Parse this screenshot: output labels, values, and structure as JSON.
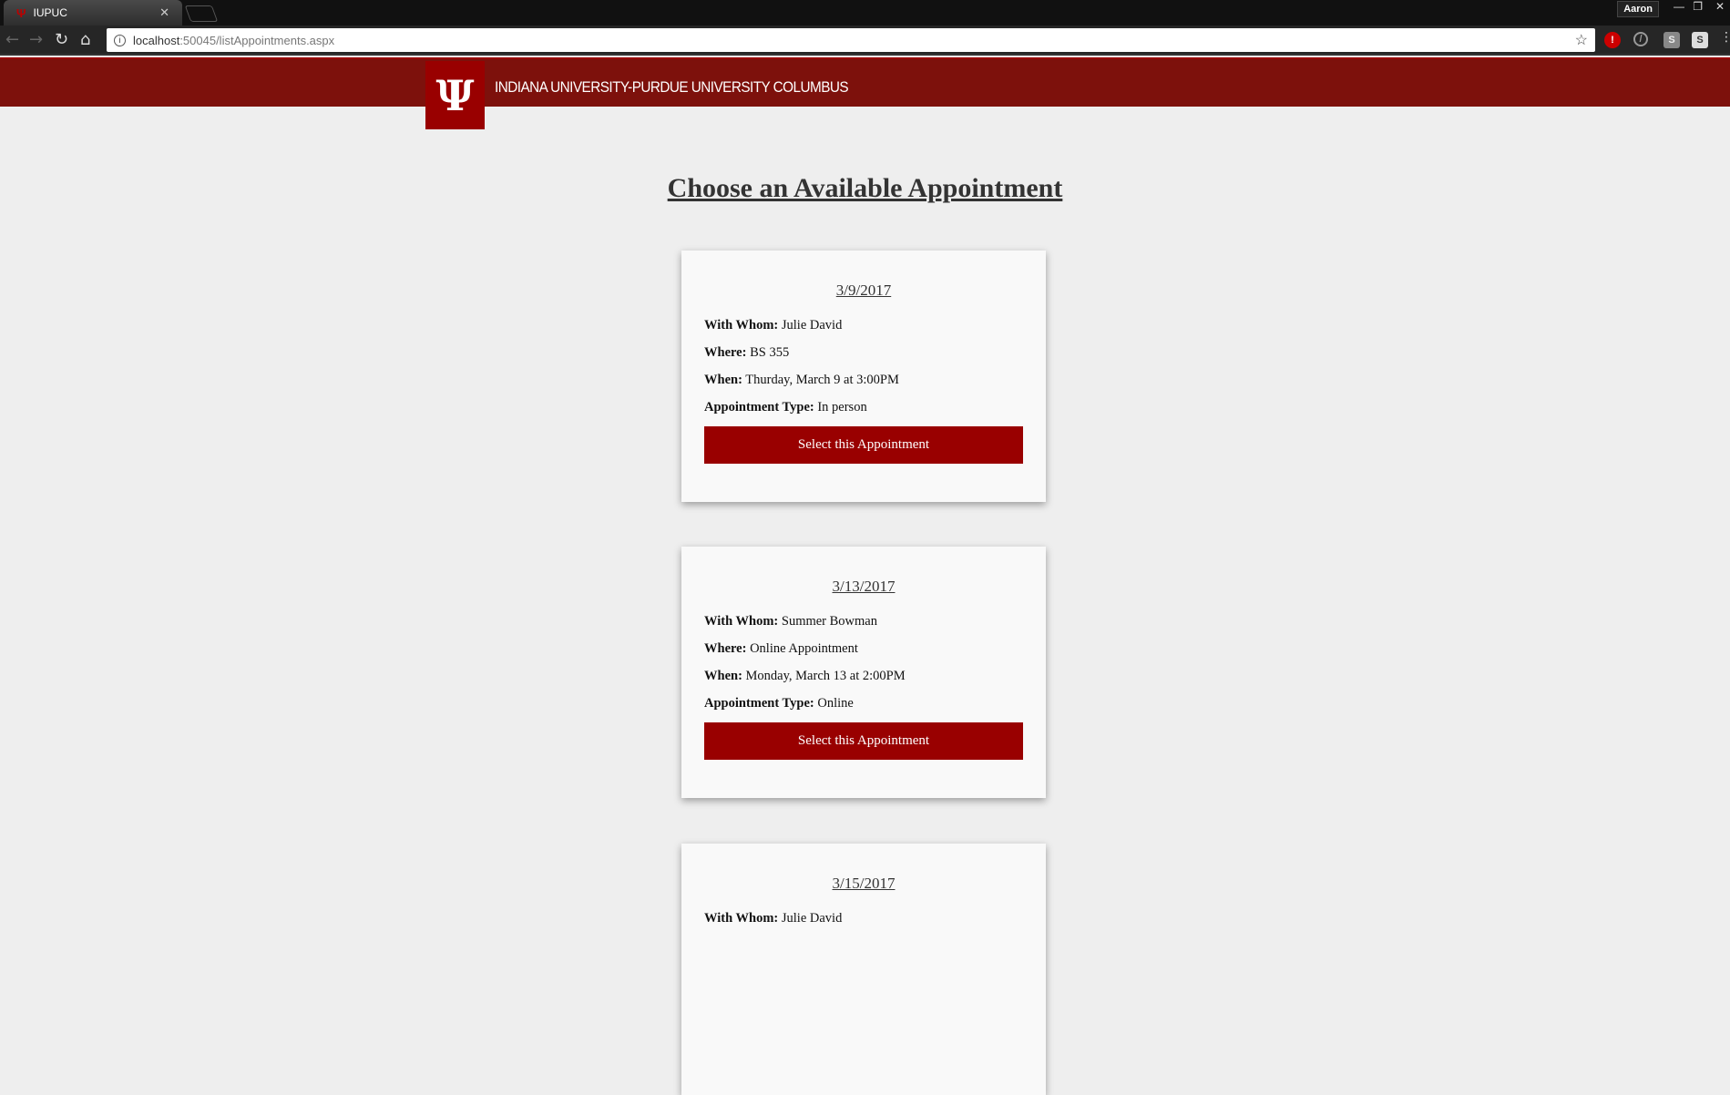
{
  "browser": {
    "tab_title": "IUPUC",
    "user": "Aaron",
    "url_host": "localhost",
    "url_rest": ":50045/listAppointments.aspx"
  },
  "header": {
    "logo_text": "IU",
    "university": "INDIANA UNIVERSITY-PURDUE UNIVERSITY COLUMBUS",
    "brand_color": "#990000"
  },
  "page": {
    "title": "Choose an Available Appointment"
  },
  "labels": {
    "with_whom": "With Whom:",
    "where": "Where:",
    "when": "When:",
    "type": "Appointment Type:",
    "button": "Select this Appointment"
  },
  "appointments": [
    {
      "date": "3/9/2017",
      "with_whom": "Julie David",
      "where": "BS 355",
      "when": "Thurday, March 9 at 3:00PM",
      "type": "In person"
    },
    {
      "date": "3/13/2017",
      "with_whom": "Summer Bowman",
      "where": "Online Appointment",
      "when": "Monday, March 13 at 2:00PM",
      "type": "Online"
    },
    {
      "date": "3/15/2017",
      "with_whom": "Julie David"
    }
  ]
}
